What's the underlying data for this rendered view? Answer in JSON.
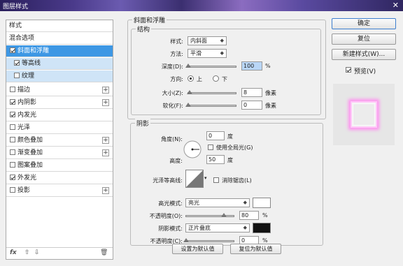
{
  "window": {
    "title": "图层样式",
    "close": "✕"
  },
  "left_panel": {
    "header": "样式",
    "blend_options": "混合选项",
    "bevel": "斜面和浮雕",
    "contour": "等高线",
    "texture": "纹理",
    "stroke": "描边",
    "inner_shadow": "内阴影",
    "inner_glow": "内发光",
    "satin": "光泽",
    "color_overlay": "颜色叠加",
    "gradient_overlay": "渐变叠加",
    "pattern_overlay": "图案叠加",
    "outer_glow": "外发光",
    "drop_shadow": "投影",
    "plus": "+",
    "footer": {
      "fx": "fx",
      "up": "⇧",
      "down": "⇩",
      "trash": "🗑"
    }
  },
  "bevel_panel": {
    "title": "斜面和浮雕",
    "structure": "结构",
    "style_label": "样式:",
    "style_value": "内斜面",
    "method_label": "方法:",
    "method_value": "平滑",
    "depth_label": "深度(D):",
    "depth_value": "100",
    "depth_unit": "%",
    "depth_level": 0,
    "direction_label": "方向:",
    "dir_up": "上",
    "dir_down": "下",
    "size_label": "大小(Z):",
    "size_value": "8",
    "size_unit": "像素",
    "size_level": 0.03,
    "soften_label": "软化(F):",
    "soften_value": "0",
    "soften_unit": "像素",
    "soften_level": 0
  },
  "shading": {
    "title": "阴影",
    "angle_label": "角度(N):",
    "angle_value": "0",
    "angle_unit": "度",
    "global_light": "使用全局光(G)",
    "altitude_label": "高度:",
    "altitude_value": "50",
    "altitude_unit": "度",
    "gloss_label": "光泽等高线:",
    "antialias": "消除锯齿(L)",
    "highlight_mode_label": "高光模式:",
    "highlight_mode_value": "亮光",
    "highlight_color": "#ffffff",
    "highlight_opacity_label": "不透明度(O):",
    "highlight_opacity_value": "80",
    "highlight_opacity_level": 0.8,
    "shadow_mode_label": "阴影模式:",
    "shadow_mode_value": "正片叠底",
    "shadow_color": "#111111",
    "shadow_opacity_label": "不透明度(C):",
    "shadow_opacity_value": "0",
    "shadow_opacity_level": 0,
    "percent": "%"
  },
  "bottom_buttons": {
    "set_default": "设置为默认值",
    "reset_default": "复位为默认值"
  },
  "right": {
    "ok": "确定",
    "reset": "复位",
    "new_style": "新建样式(W)...",
    "preview": "预览(V)"
  },
  "colors": {
    "selection": "#3d97e4",
    "sub_selection": "#cfe4f7",
    "glow": "#ff9ff5"
  }
}
